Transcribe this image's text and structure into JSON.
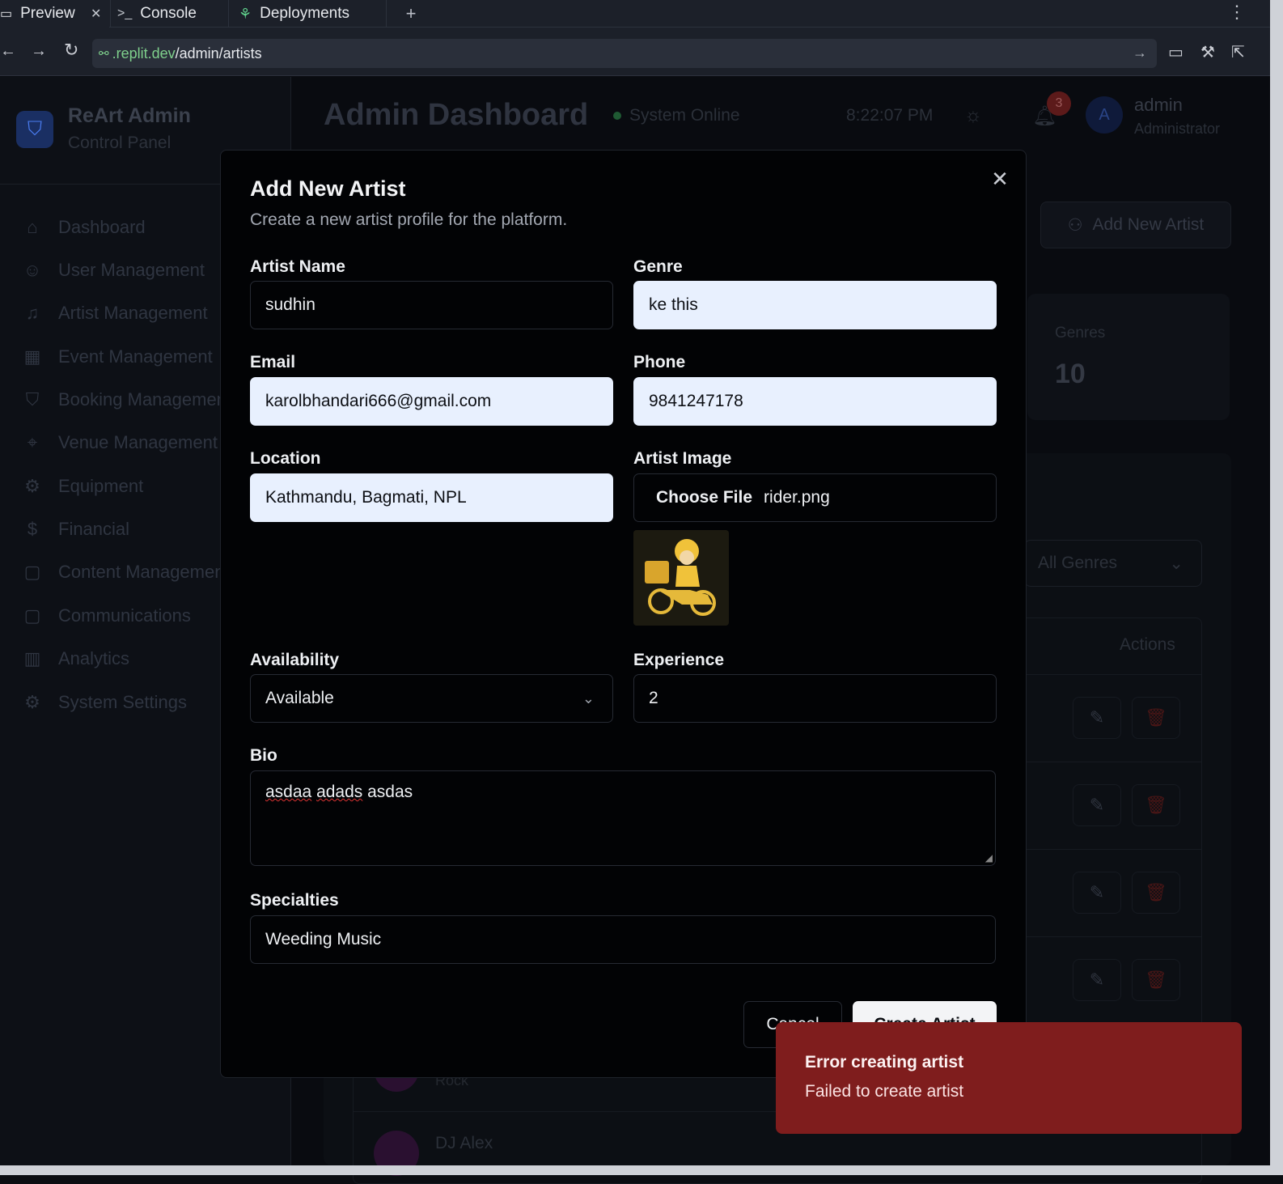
{
  "browser": {
    "tabs": [
      {
        "label": "Preview",
        "icon": "monitor-icon"
      },
      {
        "label": "Console",
        "icon": "terminal-icon"
      },
      {
        "label": "Deployments",
        "icon": "deploy-icon"
      }
    ],
    "new_tab_glyph": "+",
    "url_host": ".replit.dev",
    "url_path": "/admin/artists"
  },
  "app": {
    "brand_title": "ReArt Admin",
    "brand_subtitle": "Control Panel",
    "nav": [
      {
        "label": "Dashboard",
        "icon": "home-icon"
      },
      {
        "label": "User Management",
        "icon": "users-icon"
      },
      {
        "label": "Artist Management",
        "icon": "music-icon"
      },
      {
        "label": "Event Management",
        "icon": "calendar-icon"
      },
      {
        "label": "Booking Management",
        "icon": "shield-icon"
      },
      {
        "label": "Venue Management",
        "icon": "map-pin-icon"
      },
      {
        "label": "Equipment",
        "icon": "gear-icon"
      },
      {
        "label": "Financial",
        "icon": "dollar-icon"
      },
      {
        "label": "Content Management",
        "icon": "message-icon"
      },
      {
        "label": "Communications",
        "icon": "message-icon"
      },
      {
        "label": "Analytics",
        "icon": "bar-chart-icon"
      },
      {
        "label": "System Settings",
        "icon": "gear-icon"
      }
    ],
    "header_title": "Admin Dashboard",
    "status_text": "System Online",
    "time": "8:22:07 PM",
    "notification_count": "3",
    "user_initial": "A",
    "user_name": "admin",
    "user_role": "Administrator",
    "add_artist_label": "Add New Artist",
    "genres_card_label": "Genres",
    "genres_card_value": "10",
    "genre_filter": "All Genres",
    "actions_header": "Actions",
    "rows": [
      {
        "name": "",
        "genre": "Rock"
      },
      {
        "name": "DJ Alex",
        "genre": ""
      }
    ]
  },
  "modal": {
    "title": "Add New Artist",
    "description": "Create a new artist profile for the platform.",
    "fields": {
      "artist_name": {
        "label": "Artist Name",
        "value": "sudhin"
      },
      "genre": {
        "label": "Genre",
        "value": "ke this"
      },
      "email": {
        "label": "Email",
        "value": "karolbhandari666@gmail.com"
      },
      "phone": {
        "label": "Phone",
        "value": "9841247178"
      },
      "location": {
        "label": "Location",
        "value": "Kathmandu, Bagmati, NPL"
      },
      "artist_image": {
        "label": "Artist Image",
        "button": "Choose File",
        "filename": "rider.png"
      },
      "availability": {
        "label": "Availability",
        "value": "Available"
      },
      "experience": {
        "label": "Experience",
        "value": "2"
      },
      "bio": {
        "label": "Bio",
        "words": [
          "asdaa",
          "adads",
          "asdas"
        ]
      },
      "specialties": {
        "label": "Specialties",
        "value": "Weeding Music"
      }
    },
    "cancel_label": "Cancel",
    "create_label": "Create Artist"
  },
  "toast": {
    "title": "Error creating artist",
    "message": "Failed to create artist",
    "color": "#7f1d1d"
  }
}
